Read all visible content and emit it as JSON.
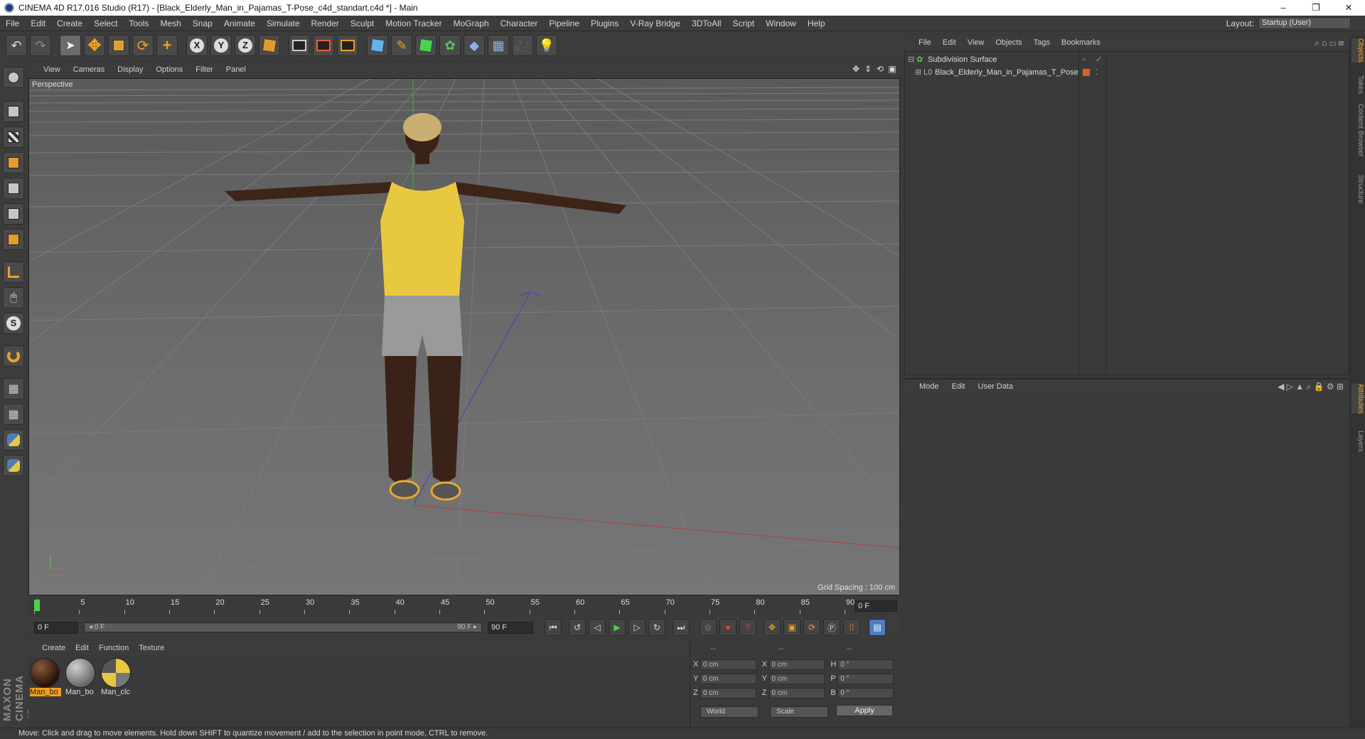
{
  "window": {
    "title": "CINEMA 4D R17.016 Studio (R17) - [Black_Elderly_Man_in_Pajamas_T-Pose_c4d_standart.c4d *] - Main",
    "controls": [
      "–",
      "❐",
      "✕"
    ]
  },
  "menubar": {
    "items": [
      "File",
      "Edit",
      "Create",
      "Select",
      "Tools",
      "Mesh",
      "Snap",
      "Animate",
      "Simulate",
      "Render",
      "Sculpt",
      "Motion Tracker",
      "MoGraph",
      "Character",
      "Pipeline",
      "Plugins",
      "V-Ray Bridge",
      "3DToAll",
      "Script",
      "Window",
      "Help"
    ],
    "layout_label": "Layout:",
    "layout_value": "Startup (User)"
  },
  "toolbar": {
    "x_label": "X",
    "y_label": "Y",
    "z_label": "Z"
  },
  "viewport": {
    "menu": [
      "View",
      "Cameras",
      "Display",
      "Options",
      "Filter",
      "Panel"
    ],
    "camera_label": "Perspective",
    "grid_spacing": "Grid Spacing : 100 cm"
  },
  "timeline": {
    "ticks": [
      "0",
      "5",
      "10",
      "15",
      "20",
      "25",
      "30",
      "35",
      "40",
      "45",
      "50",
      "55",
      "60",
      "65",
      "70",
      "75",
      "80",
      "85",
      "90"
    ],
    "end_field": "0 F",
    "current_frame": 0
  },
  "transport": {
    "start_field": "0 F",
    "range_start": "◂ 0 F",
    "range_end": "90 F ▸",
    "end_field": "90 F"
  },
  "materials": {
    "menu": [
      "Create",
      "Edit",
      "Function",
      "Texture"
    ],
    "items": [
      {
        "name": "Man_bo",
        "selected": true
      },
      {
        "name": "Man_bo",
        "selected": false
      },
      {
        "name": "Man_clc",
        "selected": false
      }
    ]
  },
  "coordinates": {
    "headers": [
      "--",
      "--",
      "--"
    ],
    "rows": [
      {
        "a": "X",
        "v1": "0 cm",
        "b": "X",
        "v2": "0 cm",
        "c": "H",
        "v3": "0 °"
      },
      {
        "a": "Y",
        "v1": "0 cm",
        "b": "Y",
        "v2": "0 cm",
        "c": "P",
        "v3": "0 °"
      },
      {
        "a": "Z",
        "v1": "0 cm",
        "b": "Z",
        "v2": "0 cm",
        "c": "B",
        "v3": "0 °"
      }
    ],
    "space": "World",
    "mode": "Scale",
    "apply": "Apply"
  },
  "objects": {
    "menu": [
      "File",
      "Edit",
      "View",
      "Objects",
      "Tags",
      "Bookmarks"
    ],
    "tree": [
      {
        "name": "Subdivision Surface"
      },
      {
        "name": "Black_Elderly_Man_in_Pajamas_T_Pose"
      }
    ]
  },
  "attributes": {
    "menu": [
      "Mode",
      "Edit",
      "User Data"
    ]
  },
  "right_tabs": [
    "Objects",
    "Takes",
    "Content Browser",
    "Structure",
    "Attributes",
    "Layers"
  ],
  "status": "Move: Click and drag to move elements. Hold down SHIFT to quantize movement / add to the selection in point mode, CTRL to remove.",
  "brand": "MAXON CINEMA 4D",
  "colors": {
    "accent": "#f0a020",
    "play": "#4ecf4e",
    "record": "#e04040"
  }
}
